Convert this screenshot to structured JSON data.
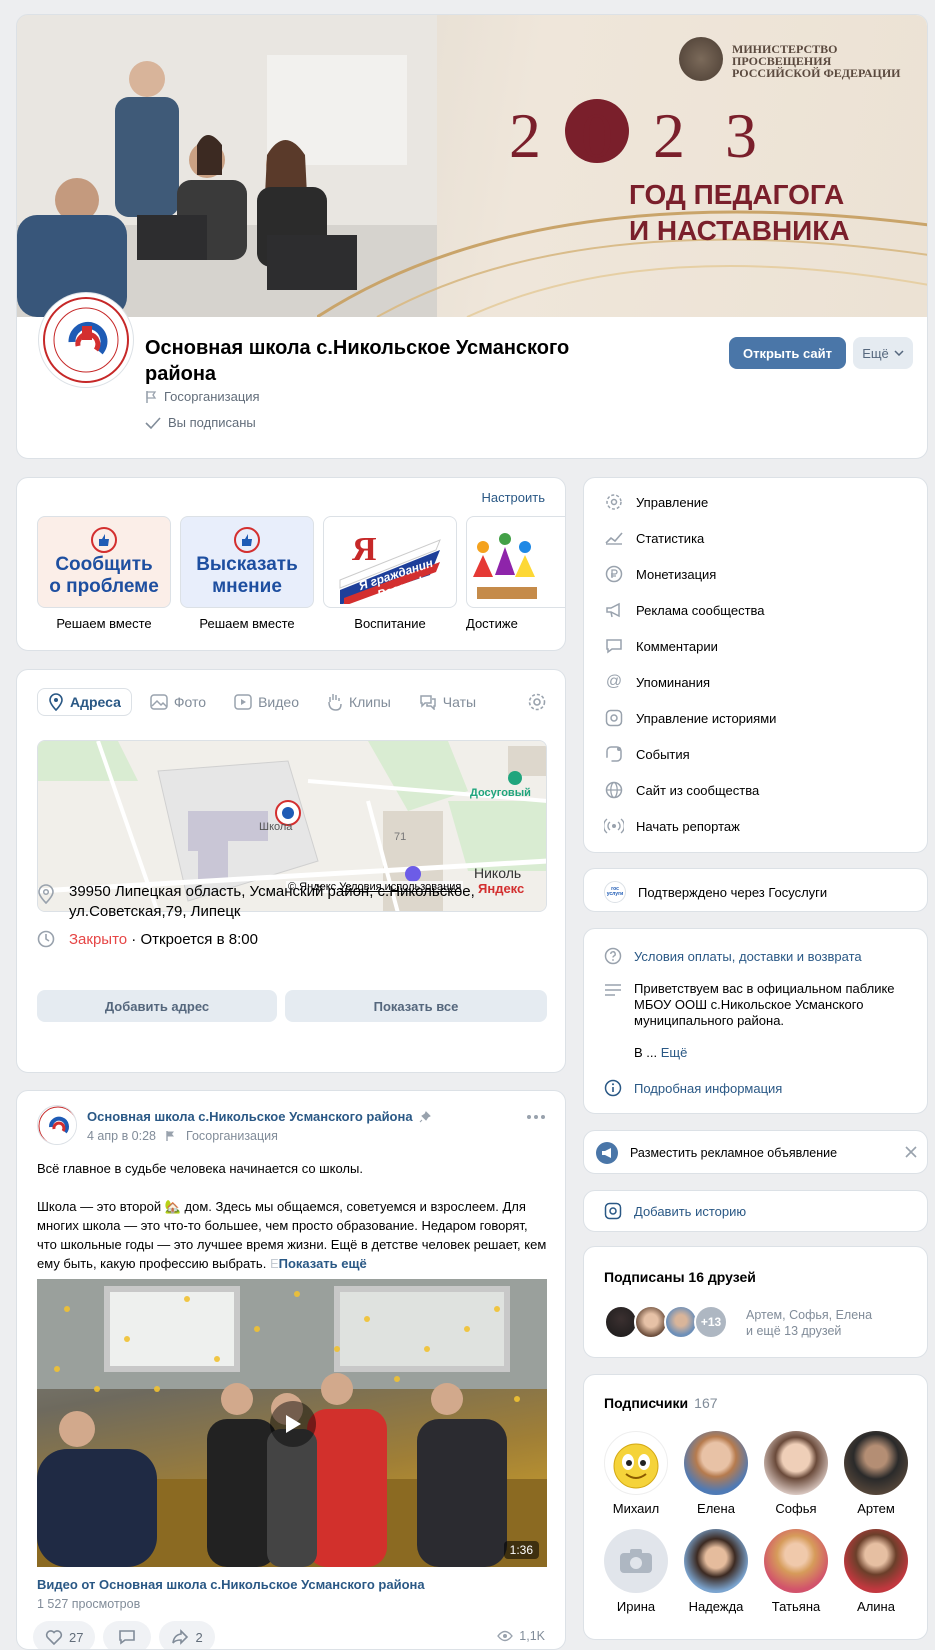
{
  "cover": {
    "ministry": "МИНИСТЕРСТВО ПРОСВЕЩЕНИЯ РОССИЙСКОЙ ФЕДЕРАЦИИ",
    "year": "2023",
    "slogan_1": "ГОД ПЕДАГОГА",
    "slogan_2": "И НАСТАВНИКА"
  },
  "group": {
    "title": "Основная школа с.Никольское Усманского района",
    "type": "Госорганизация",
    "subscribed": "Вы подписаны",
    "open_site": "Открыть сайт",
    "more": "Ещё"
  },
  "shortcuts": {
    "configure": "Настроить",
    "items": [
      {
        "tile": "Сообщить о проблеме",
        "label": "Решаем вместе"
      },
      {
        "tile": "Высказать мнение",
        "label": "Решаем вместе"
      },
      {
        "tile": "Я гражданин России!",
        "label": "Воспитание"
      },
      {
        "tile": "",
        "label": "Достиже"
      }
    ]
  },
  "addresses": {
    "tabs": [
      "Адреса",
      "Фото",
      "Видео",
      "Клипы",
      "Чаты"
    ],
    "map_labels": {
      "school": "Школа",
      "house": "71",
      "leisure": "Досуговый",
      "village": "Николь",
      "copyright": "© Яндекс",
      "terms": "Условия использования",
      "yandex": "Яндекс"
    },
    "address": "39950 Липецкая область, Усманский район, с.Никольское, ул.Советская,79, Липецк",
    "status_closed": "Закрыто",
    "status_open": " · Откроется в 8:00",
    "add_address": "Добавить адрес",
    "show_all": "Показать все"
  },
  "post": {
    "author": "Основная школа с.Никольское Усманского района",
    "date": "4 апр в 0:28",
    "tag": "Госорганизация",
    "line1": "Всё главное в судьбе человека начинается со школы.",
    "body": "Школа — это второй 🏡 дом. Здесь мы общаемся, советуемся и взрослеем. Для многих школа — это что-то большее, чем просто образование. Недаром говорят, что школьные годы — это лучшее время жизни. Ещё в детстве человек решает, кем ему быть, какую профессию выбрать. ",
    "fade": "Е",
    "show_more": "Показать ещё",
    "video_duration": "1:36",
    "video_title": "Видео от Основная школа с.Никольское Усманского района",
    "video_views": "1 527 просмотров",
    "likes": "27",
    "reposts": "2",
    "views": "1,1K"
  },
  "menu": {
    "items": [
      {
        "label": "Управление",
        "icon": "gear-icon"
      },
      {
        "label": "Статистика",
        "icon": "chart-icon"
      },
      {
        "label": "Монетизация",
        "icon": "ruble-icon"
      },
      {
        "label": "Реклама сообщества",
        "icon": "megaphone-icon"
      },
      {
        "label": "Комментарии",
        "icon": "comment-icon"
      },
      {
        "label": "Упоминания",
        "icon": "at-icon"
      },
      {
        "label": "Управление историями",
        "icon": "stories-icon"
      },
      {
        "label": "События",
        "icon": "event-icon"
      },
      {
        "label": "Сайт из сообщества",
        "icon": "globe-icon"
      },
      {
        "label": "Начать репортаж",
        "icon": "broadcast-icon"
      }
    ]
  },
  "gosuslugi": {
    "label": "Подтверждено через Госуслуги",
    "logo": "гос услуги"
  },
  "info": {
    "payment": "Условия оплаты, доставки и возврата",
    "description": "Приветствуем вас в официальном паблике МБОУ ООШ с.Никольское Усманского муниципального района.",
    "more_prefix": "В ... ",
    "more": "Ещё",
    "details": "Подробная информация"
  },
  "ad": {
    "label": "Разместить рекламное объявление"
  },
  "story": {
    "label": "Добавить историю"
  },
  "friends": {
    "title": "Подписаны 16 друзей",
    "extra": "+13",
    "names": "Артем, Софья, Елена",
    "more": "и ещё 13 друзей"
  },
  "followers": {
    "title": "Подписчики",
    "count": "167",
    "people": [
      "Михаил",
      "Елена",
      "Софья",
      "Артем",
      "Ирина",
      "Надежда",
      "Татьяна",
      "Алина"
    ]
  },
  "colors": {
    "accent": "#4a76a8",
    "link": "#2a5885",
    "closed": "#e64646",
    "bg": "#edeef0"
  }
}
